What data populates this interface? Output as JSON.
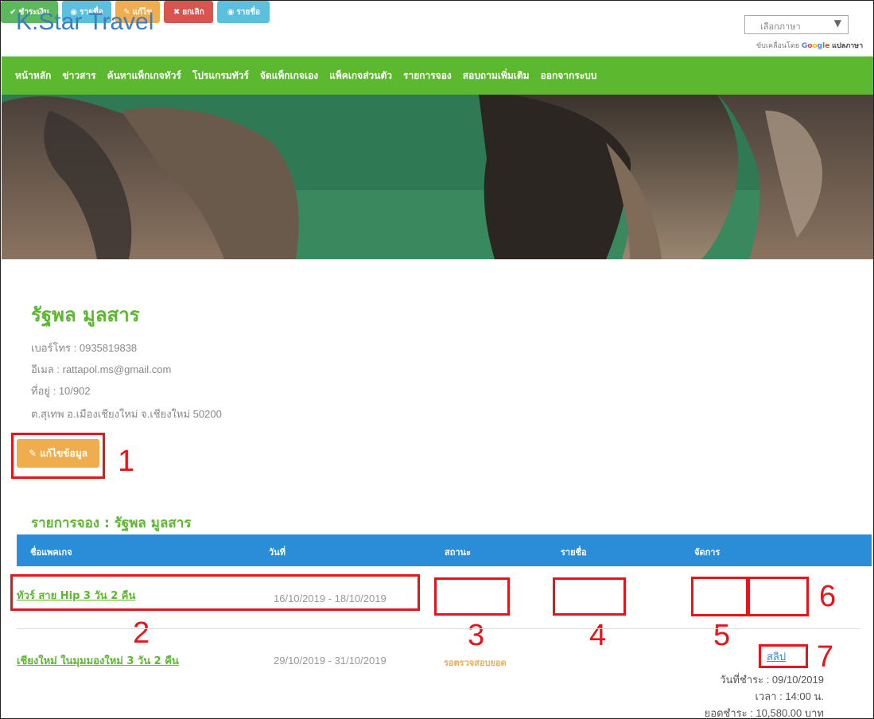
{
  "header": {
    "logo": "K.Star Travel",
    "language_select": "เลือกภาษา",
    "powered_prefix": "ขับเคลื่อนโดย",
    "google": [
      "G",
      "o",
      "o",
      "g",
      "l",
      "e"
    ],
    "translate": "แปลภาษา"
  },
  "nav": {
    "items": [
      "หน้าหลัก",
      "ข่าวสาร",
      "ค้นหาแพ็กเกจทัวร์",
      "โปรแกรมทัวร์",
      "จัดแพ็กเกจเอง",
      "แพ็คเกจส่วนตัว",
      "รายการจอง",
      "สอบถามเพิ่มเติม",
      "ออกจากระบบ"
    ]
  },
  "profile": {
    "name": "รัฐพล มูลสาร",
    "phone": "เบอร์โทร : 0935819838",
    "email": "อีเมล : rattapol.ms@gmail.com",
    "address1": "ที่อยู่ : 10/902",
    "address2": "ต.สุเทพ อ.เมืองเชียงใหม่ จ.เชียงใหม่ 50200",
    "edit_button": "แก้ไขข้อมูล",
    "edit_icon": "edit-icon"
  },
  "bookings": {
    "title": "รายการจอง : รัฐพล มูลสาร",
    "columns": [
      "ชื่อแพคเกจ",
      "วันที่",
      "สถานะ",
      "รายชื่อ",
      "จัดการ"
    ],
    "rows": [
      {
        "package": "ทัวร์ สาย Hip 3 วัน 2 คืน",
        "date": "16/10/2019 - 18/10/2019",
        "pay_button": "ชำระเงิน",
        "names_button": "รายชื่อ",
        "edit_button": "แก้ไข",
        "cancel_button": "ยกเลิก"
      },
      {
        "package": "เชียงใหม่ ในมุมมองใหม่ 3 วัน 2 คืน",
        "date": "29/10/2019 - 31/10/2019",
        "status": "รอตรวจสอบยอด",
        "names_button": "รายชื่อ",
        "slip_link": "สลิป",
        "pay_date": "วันที่ชำระ : 09/10/2019",
        "pay_time": "เวลา : 14:00 น.",
        "pay_amount": "ยอดชำระ : 10,580.00 บาท"
      }
    ]
  },
  "annotations": [
    "1",
    "2",
    "3",
    "4",
    "5",
    "6",
    "7"
  ],
  "colors": {
    "brand_green": "#5cb82e",
    "header_blue": "#2b8dd8",
    "logo_blue": "#3b7dbd",
    "warning": "#f0ad4e",
    "success": "#5cb85c",
    "info": "#5bc0de",
    "danger": "#d9534f",
    "annotation_red": "#e8141c"
  }
}
